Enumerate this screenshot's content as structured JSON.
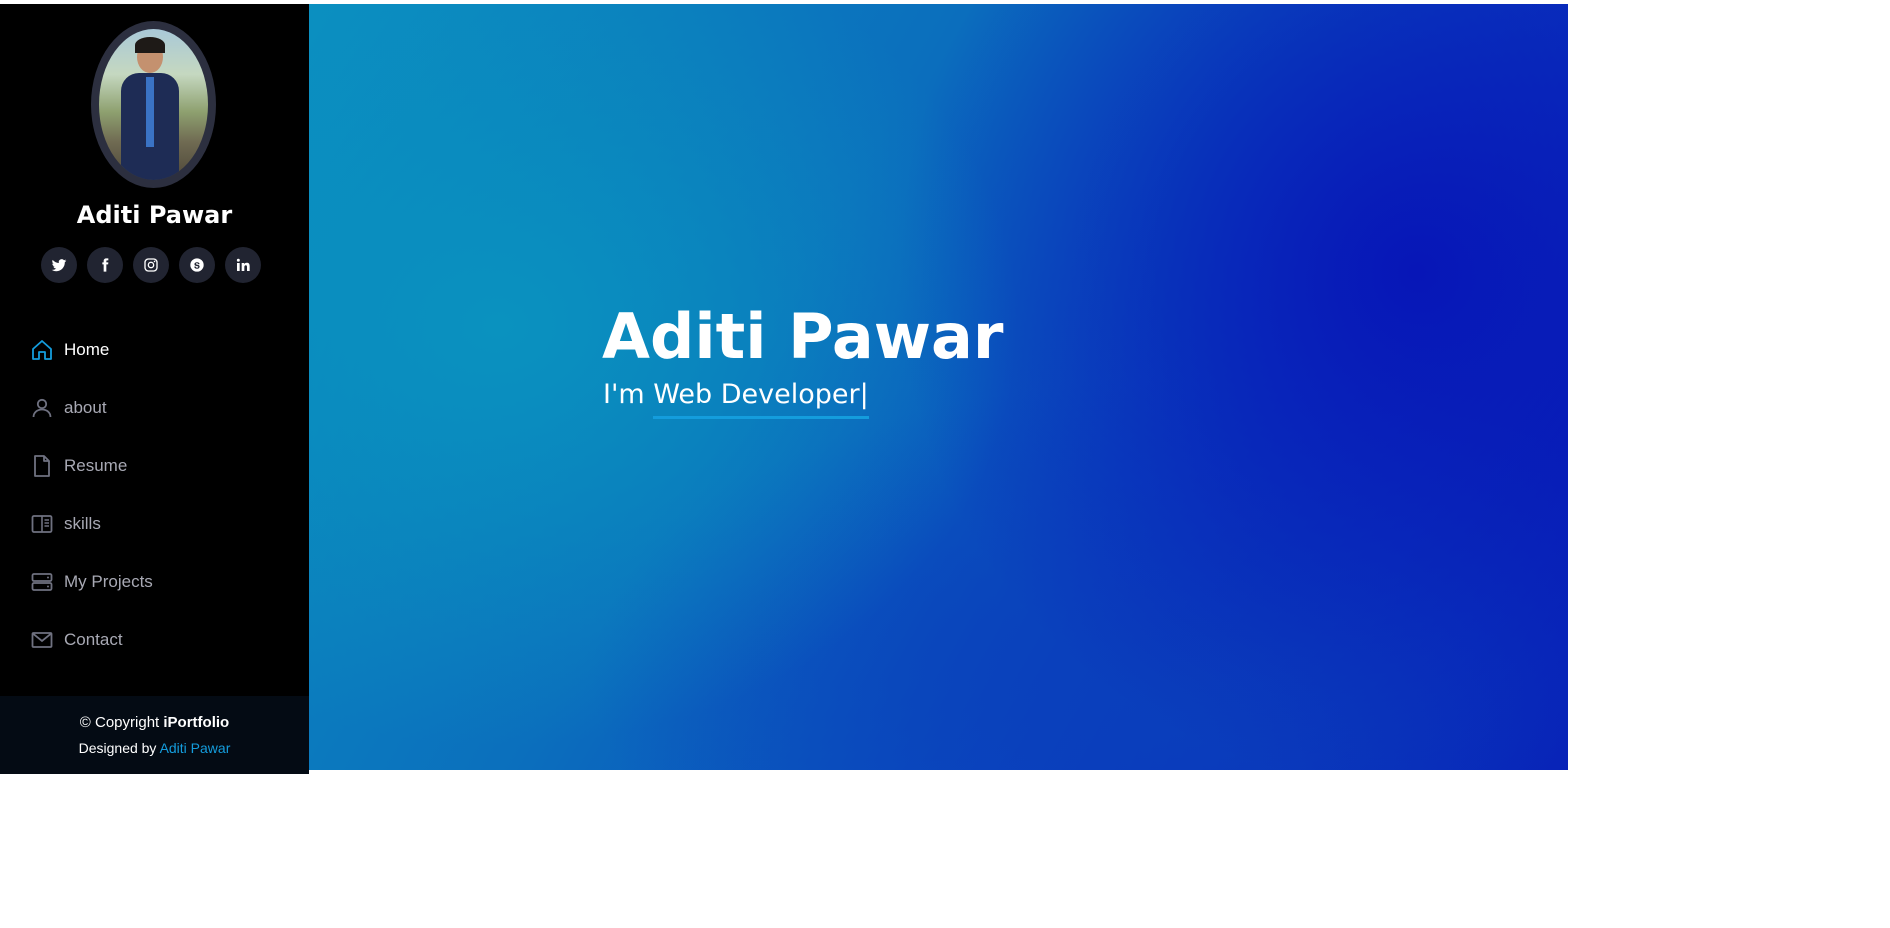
{
  "sidebar": {
    "name": "Aditi Pawar",
    "social": [
      {
        "icon": "twitter-icon"
      },
      {
        "icon": "facebook-icon"
      },
      {
        "icon": "instagram-icon"
      },
      {
        "icon": "skype-icon"
      },
      {
        "icon": "linkedin-icon"
      }
    ],
    "nav": [
      {
        "label": "Home",
        "icon": "home-icon",
        "active": true
      },
      {
        "label": "about",
        "icon": "person-icon"
      },
      {
        "label": "Resume",
        "icon": "file-icon"
      },
      {
        "label": "skills",
        "icon": "book-icon"
      },
      {
        "label": "My Projects",
        "icon": "server-icon"
      },
      {
        "label": "Contact",
        "icon": "envelope-icon"
      }
    ],
    "footer": {
      "copyright": "© Copyright",
      "brand": "iPortfolio",
      "designed_by": "Designed by",
      "author": "Aditi Pawar"
    }
  },
  "hero": {
    "title": "Aditi Pawar",
    "prefix": "I'm",
    "typed": "Web Developer",
    "cursor": "|"
  },
  "colors": {
    "accent": "#149ddd",
    "sidebar_bg": "#000000",
    "footer_bg": "#040b14",
    "social_bg": "#212431",
    "hero_gradient_start": "#0b8fc0",
    "hero_gradient_end": "#0716b7"
  }
}
